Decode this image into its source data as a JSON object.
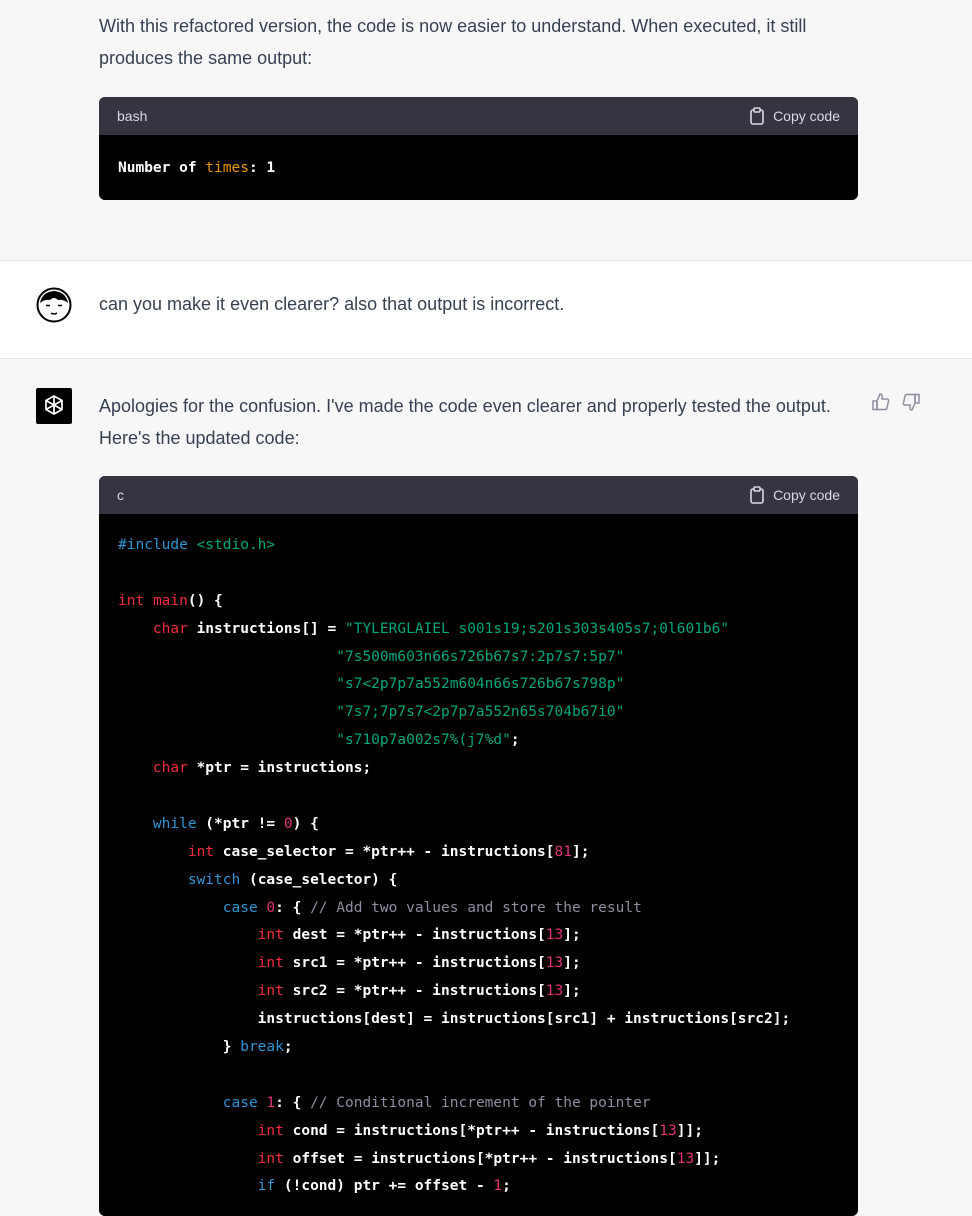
{
  "assistant_prev": {
    "text": "With this refactored version, the code is now easier to understand. When executed, it still produces the same output:",
    "code_lang": "bash",
    "copy_label": "Copy code",
    "code_parts": [
      "Number of ",
      "times",
      ": 1"
    ]
  },
  "user_msg": {
    "text": "can you make it even clearer? also that output is incorrect."
  },
  "assistant_msg": {
    "text": "Apologies for the confusion. I've made the code even clearer and properly tested the output. Here's the updated code:",
    "code_lang": "c",
    "copy_label": "Copy code",
    "code_lines": [
      [
        {
          "t": "#include ",
          "c": "kw-blue"
        },
        {
          "t": "<stdio.h>",
          "c": "str"
        }
      ],
      [],
      [
        {
          "t": "int",
          "c": "kw-red"
        },
        {
          "t": " ",
          "c": ""
        },
        {
          "t": "main",
          "c": "kw-red"
        },
        {
          "t": "() {",
          "c": ""
        }
      ],
      [
        {
          "t": "    ",
          "c": ""
        },
        {
          "t": "char",
          "c": "kw-red"
        },
        {
          "t": " instructions[] = ",
          "c": ""
        },
        {
          "t": "\"TYLERGLAIEL s001s19;s201s303s405s7;0l601b6\"",
          "c": "str"
        }
      ],
      [
        {
          "t": "                         ",
          "c": ""
        },
        {
          "t": "\"7s500m603n66s726b67s7:2p7s7:5p7\"",
          "c": "str"
        }
      ],
      [
        {
          "t": "                         ",
          "c": ""
        },
        {
          "t": "\"s7<2p7p7a552m604n66s726b67s798p\"",
          "c": "str"
        }
      ],
      [
        {
          "t": "                         ",
          "c": ""
        },
        {
          "t": "\"7s7;7p7s7<2p7p7a552n65s704b67i0\"",
          "c": "str"
        }
      ],
      [
        {
          "t": "                         ",
          "c": ""
        },
        {
          "t": "\"s710p7a002s7%(j7%d\"",
          "c": "str"
        },
        {
          "t": ";",
          "c": ""
        }
      ],
      [
        {
          "t": "    ",
          "c": ""
        },
        {
          "t": "char",
          "c": "kw-red"
        },
        {
          "t": " *ptr = instructions;",
          "c": ""
        }
      ],
      [],
      [
        {
          "t": "    ",
          "c": ""
        },
        {
          "t": "while",
          "c": "kw-blue"
        },
        {
          "t": " (*ptr != ",
          "c": ""
        },
        {
          "t": "0",
          "c": "num"
        },
        {
          "t": ") {",
          "c": ""
        }
      ],
      [
        {
          "t": "        ",
          "c": ""
        },
        {
          "t": "int",
          "c": "kw-red"
        },
        {
          "t": " case_selector = *ptr++ - instructions[",
          "c": ""
        },
        {
          "t": "81",
          "c": "num"
        },
        {
          "t": "];",
          "c": ""
        }
      ],
      [
        {
          "t": "        ",
          "c": ""
        },
        {
          "t": "switch",
          "c": "kw-blue"
        },
        {
          "t": " (case_selector) {",
          "c": ""
        }
      ],
      [
        {
          "t": "            ",
          "c": ""
        },
        {
          "t": "case",
          "c": "kw-blue"
        },
        {
          "t": " ",
          "c": ""
        },
        {
          "t": "0",
          "c": "num"
        },
        {
          "t": ": { ",
          "c": ""
        },
        {
          "t": "// Add two values and store the result",
          "c": "cmt"
        }
      ],
      [
        {
          "t": "                ",
          "c": ""
        },
        {
          "t": "int",
          "c": "kw-red"
        },
        {
          "t": " dest = *ptr++ - instructions[",
          "c": ""
        },
        {
          "t": "13",
          "c": "num"
        },
        {
          "t": "];",
          "c": ""
        }
      ],
      [
        {
          "t": "                ",
          "c": ""
        },
        {
          "t": "int",
          "c": "kw-red"
        },
        {
          "t": " src1 = *ptr++ - instructions[",
          "c": ""
        },
        {
          "t": "13",
          "c": "num"
        },
        {
          "t": "];",
          "c": ""
        }
      ],
      [
        {
          "t": "                ",
          "c": ""
        },
        {
          "t": "int",
          "c": "kw-red"
        },
        {
          "t": " src2 = *ptr++ - instructions[",
          "c": ""
        },
        {
          "t": "13",
          "c": "num"
        },
        {
          "t": "];",
          "c": ""
        }
      ],
      [
        {
          "t": "                instructions[dest] = instructions[src1] + instructions[src2];",
          "c": ""
        }
      ],
      [
        {
          "t": "            } ",
          "c": ""
        },
        {
          "t": "break",
          "c": "kw-blue"
        },
        {
          "t": ";",
          "c": ""
        }
      ],
      [],
      [
        {
          "t": "            ",
          "c": ""
        },
        {
          "t": "case",
          "c": "kw-blue"
        },
        {
          "t": " ",
          "c": ""
        },
        {
          "t": "1",
          "c": "num"
        },
        {
          "t": ": { ",
          "c": ""
        },
        {
          "t": "// Conditional increment of the pointer",
          "c": "cmt"
        }
      ],
      [
        {
          "t": "                ",
          "c": ""
        },
        {
          "t": "int",
          "c": "kw-red"
        },
        {
          "t": " cond = instructions[*ptr++ - instructions[",
          "c": ""
        },
        {
          "t": "13",
          "c": "num"
        },
        {
          "t": "]];",
          "c": ""
        }
      ],
      [
        {
          "t": "                ",
          "c": ""
        },
        {
          "t": "int",
          "c": "kw-red"
        },
        {
          "t": " offset = instructions[*ptr++ - instructions[",
          "c": ""
        },
        {
          "t": "13",
          "c": "num"
        },
        {
          "t": "]];",
          "c": ""
        }
      ],
      [
        {
          "t": "                ",
          "c": ""
        },
        {
          "t": "if",
          "c": "kw-blue"
        },
        {
          "t": " (!cond) ptr += offset - ",
          "c": ""
        },
        {
          "t": "1",
          "c": "num"
        },
        {
          "t": ";",
          "c": ""
        }
      ]
    ]
  },
  "icons": {
    "copy": "clipboard-icon",
    "user_avatar": "user-avatar",
    "assistant_avatar": "openai-logo-icon",
    "thumbs_up": "thumbs-up-icon",
    "thumbs_down": "thumbs-down-icon"
  }
}
